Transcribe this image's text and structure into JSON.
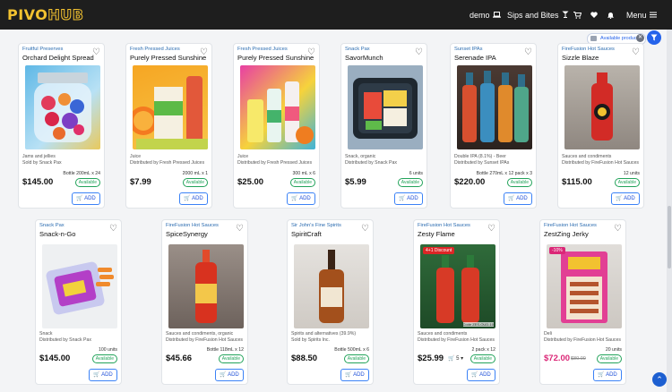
{
  "header": {
    "logo_part1": "PIVO",
    "logo_part2": "HUB",
    "user_label": "demo",
    "store_label": "Sips and Bites",
    "menu_label": "Menu"
  },
  "filter_chip": {
    "label": "Available products"
  },
  "colors": {
    "accent": "#2563eb",
    "brand_yellow": "#f2c230",
    "header_bg": "#1e1e1e",
    "available_green": "#22a35a",
    "sale_pink": "#db2777"
  },
  "products_row1": [
    {
      "category": "Fruitful Preserves",
      "name": "Orchard Delight Spread",
      "desc1": "Jams and jellies",
      "desc2": "Sold by Snack Pax",
      "pack": "Bottle 200mL x 24",
      "price": "$145.00",
      "availability": "Available",
      "add_label": "ADD"
    },
    {
      "category": "Fresh Pressed Juices",
      "name": "Purely Pressed Sunshine",
      "desc1": "Juice",
      "desc2": "Distributed by Fresh Pressed Juices",
      "pack": "2000 mL x 1",
      "price": "$7.99",
      "availability": "Available",
      "add_label": "ADD"
    },
    {
      "category": "Fresh Pressed Juices",
      "name": "Purely Pressed Sunshine",
      "desc1": "Juice",
      "desc2": "Distributed by Fresh Pressed Juices",
      "pack": "300 mL x 6",
      "price": "$25.00",
      "availability": "Available",
      "add_label": "ADD"
    },
    {
      "category": "Snack Pax",
      "name": "SavorMunch",
      "desc1": "Snack, organic",
      "desc2": "Distributed by Snack Pax",
      "pack": "6 units",
      "price": "$5.99",
      "availability": "Available",
      "add_label": "ADD"
    },
    {
      "category": "Sunset IPAs",
      "name": "Serenade IPA",
      "desc1": "Double IPA (8.1%) - Beer",
      "desc2": "Distributed by Sunset IPAs",
      "pack": "Bottle 270mL x 12 pack x 3",
      "price": "$220.00",
      "availability": "Available",
      "add_label": "ADD"
    },
    {
      "category": "FireFusion Hot Sauces",
      "name": "Sizzle Blaze",
      "desc1": "Sauces and condiments",
      "desc2": "Distributed by FireFusion Hot Sauces",
      "pack": "12 units",
      "price": "$115.00",
      "availability": "Available",
      "add_label": "ADD"
    }
  ],
  "products_row2": [
    {
      "category": "Snack Pax",
      "name": "Snack-n-Go",
      "desc1": "Snack",
      "desc2": "Distributed by Snack Pax",
      "pack": "100 units",
      "price": "$145.00",
      "availability": "Available",
      "add_label": "ADD"
    },
    {
      "category": "FireFusion Hot Sauces",
      "name": "SpiceSynergy",
      "desc1": "Sauces and condiments, organic",
      "desc2": "Distributed by FireFusion Hot Sauces",
      "pack": "Bottle 118mL x 12",
      "price": "$45.66",
      "availability": "Available",
      "add_label": "ADD"
    },
    {
      "category": "Sir John's Fine Spirits",
      "name": "SpiritCraft",
      "desc1": "Spirits and alternatives (39.9%)",
      "desc2": "Sold by Spirits Inc.",
      "pack": "Bottle 500mL x 6",
      "price": "$88.50",
      "availability": "Available",
      "add_label": "ADD"
    },
    {
      "category": "FireFusion Hot Sauces",
      "name": "Zesty Flame",
      "badge": "4+1 Discount",
      "img_code": "Code ZES-OUD-10",
      "desc1": "Sauces and condiments",
      "desc2": "Distributed by FireFusion Hot Sauces",
      "pack": "2 pack x 12",
      "price": "$25.99",
      "qty": "5",
      "availability": "Available",
      "add_label": "ADD"
    },
    {
      "category": "FireFusion Hot Sauces",
      "name": "ZestZing Jerky",
      "badge": "-10%",
      "desc1": "Deli",
      "desc2": "Distributed by FireFusion Hot Sauces",
      "pack": "20 units",
      "price": "$72.00",
      "old_price": "$80.00",
      "availability": "Available",
      "add_label": "ADD"
    }
  ]
}
